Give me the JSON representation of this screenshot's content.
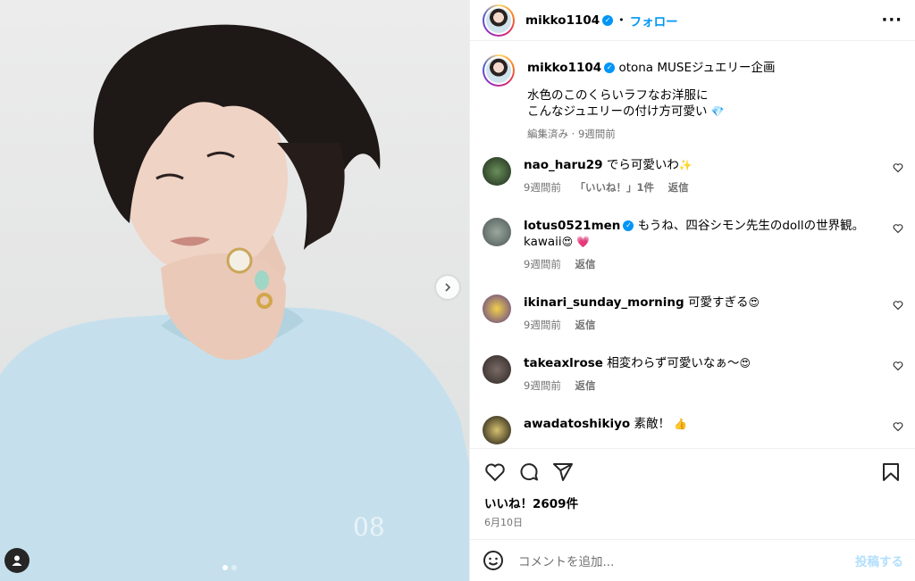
{
  "post_author": {
    "username": "mikko1104",
    "follow_label": "フォロー",
    "dot": "•"
  },
  "caption": {
    "username": "mikko1104",
    "title": "otona MUSEジュエリー企画",
    "line1": "水色のこのくらいラフなお洋服に",
    "line2": "こんなジュエリーの付け方可愛い",
    "emoji": "💎",
    "meta": "編集済み · 9週間前"
  },
  "comments": [
    {
      "username": "nao_haru29",
      "text": "でら可愛いわ",
      "emoji": "✨",
      "time": "9週間前",
      "likes": "「いいね！」1件",
      "reply": "返信"
    },
    {
      "username": "lotus0521men",
      "text": "もうね、四谷シモン先生のdollの世界観。",
      "text2": "kawaii",
      "emoji": "😍 💗",
      "time": "9週間前",
      "reply": "返信"
    },
    {
      "username": "ikinari_sunday_morning",
      "text": "可愛すぎる",
      "emoji": "😍",
      "time": "9週間前",
      "reply": "返信"
    },
    {
      "username": "takeaxlrose",
      "text": "相変わらず可愛いなぁ〜",
      "emoji": "😍",
      "time": "9週間前",
      "reply": "返信"
    },
    {
      "username": "awadatoshikiyo",
      "text": "素敵！",
      "emoji": "👍"
    }
  ],
  "likes_count": "いいね！2609件",
  "date": "6月10日",
  "comment_box": {
    "placeholder": "コメントを追加...",
    "post_label": "投稿する"
  },
  "colors": {
    "accent": "#0095f6",
    "muted": "#737373",
    "sweater": "#bfdcea"
  },
  "icons": [
    "chevron-right-icon",
    "user-tag-icon",
    "more-icon",
    "verified-badge-icon",
    "heart-icon",
    "comment-icon",
    "share-icon",
    "bookmark-icon",
    "emoji-icon"
  ]
}
